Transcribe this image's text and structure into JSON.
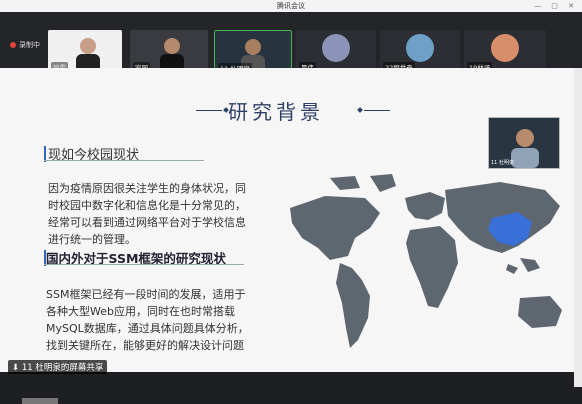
{
  "app": {
    "title": "腾讯会议"
  },
  "recording": {
    "label": "录制中"
  },
  "participants": [
    {
      "name": "韵雯",
      "avatar_color": "#d9d9d9"
    },
    {
      "name": "家园",
      "avatar_color": "#3b3b40"
    },
    {
      "name": "11 杜明泉",
      "avatar_color": "#2f3a4a"
    },
    {
      "name": "昊伟",
      "avatar_color": "#8a93b8"
    },
    {
      "name": "22程世奇",
      "avatar_color": "#6fa0c8"
    },
    {
      "name": "19林涵",
      "avatar_color": "#d78d6a"
    }
  ],
  "slide": {
    "title": "研究背景",
    "section1_heading": "现如今校园现状",
    "section1_text": "因为疫情原因很关注学生的身体状况，同时校园中数字化和信息化是十分常见的，经常可以看到通过网络平台对于学校信息进行统一的管理。",
    "section2_heading": "国内外对于SSM框架的研究现状",
    "section2_text": "SSM框架已经有一段时间的发展，适用于各种大型Web应用，同时在也时常搭载MySQL数据库，通过具体问题具体分析，找到关键所在，能够更好的解决设计问题",
    "map_highlight_color": "#3a6fd8",
    "map_color": "#5e6670"
  },
  "pip": {
    "label": "11 杜明泉"
  },
  "screen_share": {
    "label": "11 杜明泉的屏幕共享"
  },
  "colors": {
    "accent": "#2e3f66",
    "record_red": "#e5443c"
  }
}
